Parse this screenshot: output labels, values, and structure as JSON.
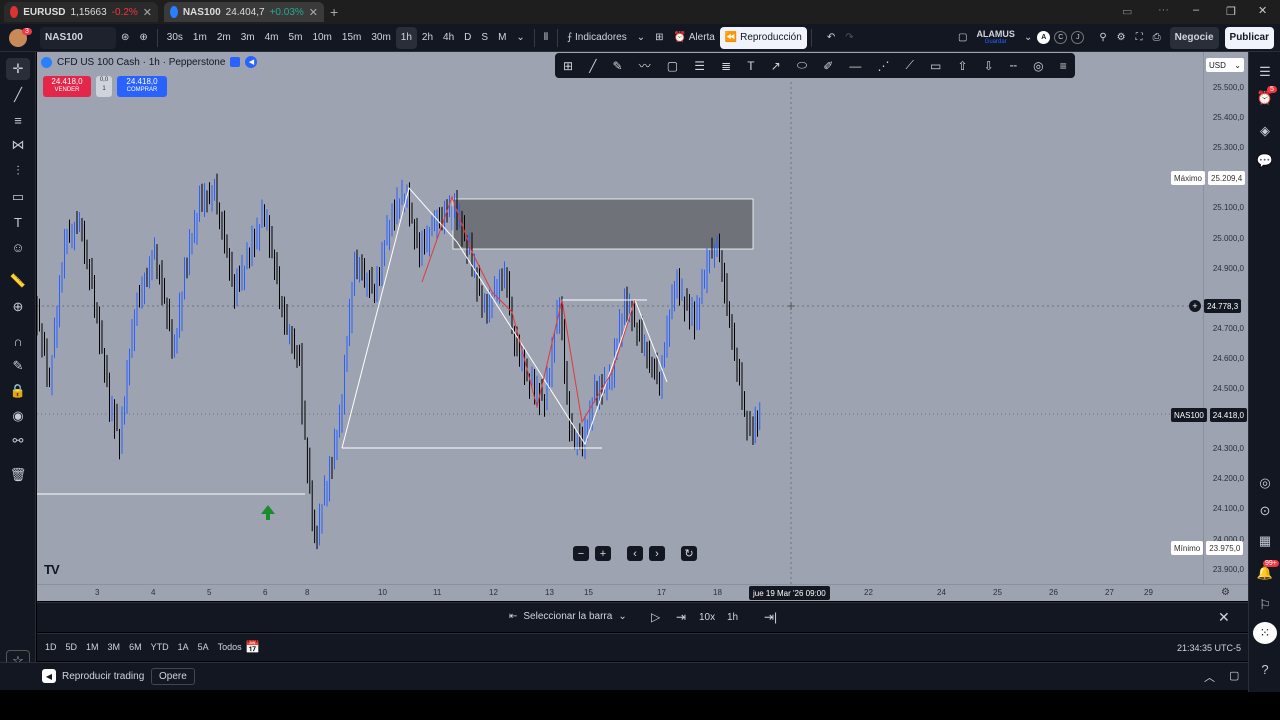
{
  "tabs": [
    {
      "symbol": "EURUSD",
      "price": "1,15663",
      "change": "-0.2%",
      "extra": "/ ..."
    },
    {
      "symbol": "NAS100",
      "price": "24.404,7",
      "change": "+0.03%",
      "extra": "/"
    }
  ],
  "toolbar": {
    "symbol": "NAS100",
    "intervals": [
      "30s",
      "1m",
      "2m",
      "3m",
      "4m",
      "5m",
      "10m",
      "15m",
      "30m",
      "1h",
      "2h",
      "4h",
      "D",
      "S",
      "M"
    ],
    "selected_interval": "1h",
    "indicators": "Indicadores",
    "alert": "Alerta",
    "replay": "Reproducción",
    "layout_name": "ALAMUS",
    "layout_sub": "Guardar",
    "layout_badges": [
      "A",
      "C",
      "J"
    ],
    "trade": "Negocie",
    "publish": "Publicar"
  },
  "chart": {
    "title": "CFD US 100 Cash · 1h · Pepperstone",
    "sell_price": "24.418,0",
    "sell_label": "VENDER",
    "spread_top": "0,0",
    "spread_bottom": "1",
    "buy_price": "24.418,0",
    "buy_label": "COMPRAR",
    "currency": "USD",
    "watermark": "TV"
  },
  "price_scale": {
    "labels": [
      "25.500,0",
      "25.400,0",
      "25.300,0",
      "25.100,0",
      "25.000,0",
      "24.900,0",
      "24.700,0",
      "24.600,0",
      "24.500,0",
      "24.300,0",
      "24.200,0",
      "24.100,0",
      "24.000,0",
      "23.900,0"
    ],
    "max_label": "Máximo",
    "max_value": "25.209,4",
    "crosshair_value": "24.778,3",
    "current_symbol": "NAS100",
    "current_value": "24.418,0",
    "min_label": "Mínimo",
    "min_value": "23.975,0"
  },
  "time_scale": {
    "labels": [
      "3",
      "4",
      "5",
      "6",
      "8",
      "10",
      "11",
      "12",
      "13",
      "15",
      "17",
      "18",
      "22",
      "24",
      "25",
      "26",
      "27",
      "29"
    ],
    "crosshair_time": "jue 19 Mar '26   09:00"
  },
  "replay_bar": {
    "select_bar": "Seleccionar la barra",
    "speed": "10x",
    "interval": "1h"
  },
  "range_bar": {
    "ranges": [
      "1D",
      "5D",
      "1M",
      "3M",
      "6M",
      "YTD",
      "1A",
      "5A",
      "Todos"
    ],
    "clock": "21:34:35 UTC-5"
  },
  "bottom_bar": {
    "replay_trading": "Reproducir trading",
    "trade": "Opere"
  },
  "badges": {
    "alerts": "5",
    "notifications": "99+",
    "avatar": "3"
  },
  "colors": {
    "bull": "#2962ff",
    "bear": "#000000",
    "sell": "#e3264a",
    "buy": "#2962ff",
    "chart_bg": "#9da3b1"
  }
}
